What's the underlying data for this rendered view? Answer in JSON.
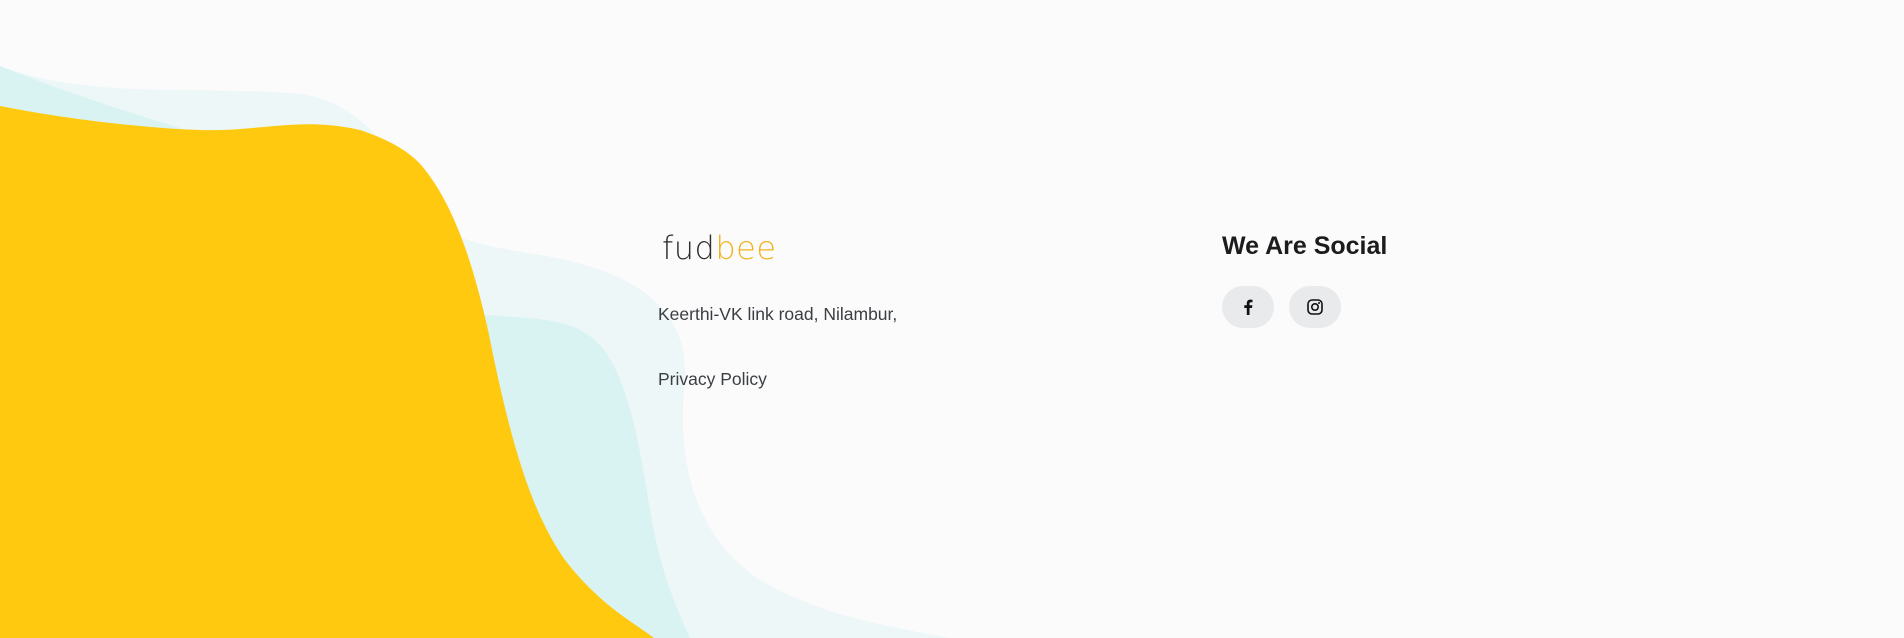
{
  "footer": {
    "logo": {
      "part_a": "fud",
      "part_b": "bee"
    },
    "address": "Keerthi-VK link road, Nilambur,",
    "privacy_label": "Privacy Policy",
    "social_title": "We Are Social",
    "social_links": [
      {
        "icon": "facebook-icon"
      },
      {
        "icon": "instagram-icon"
      }
    ]
  },
  "colors": {
    "page_background": "#fbfbfc",
    "wave_yellow": "#ffc90f",
    "wave_teal": "#d9f3f3",
    "wave_pale": "#edf7f7",
    "logo_accent": "#f3b21f",
    "social_button": "#e9eaeb"
  }
}
